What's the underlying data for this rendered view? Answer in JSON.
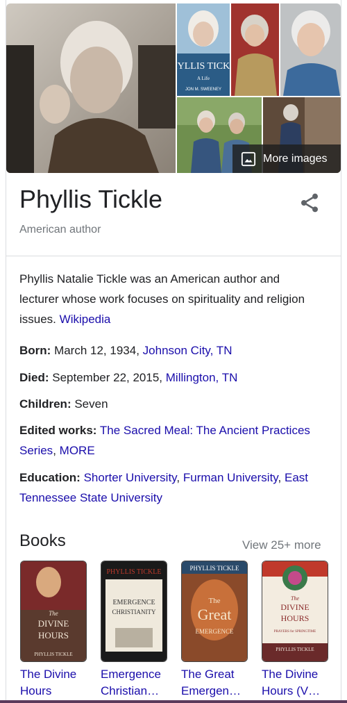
{
  "images": {
    "more_images_label": "More images",
    "book_cover_title": "PHYLLIS TICKLE",
    "book_cover_sub": "A Life",
    "book_cover_author": "JON M. SWEENEY"
  },
  "entity": {
    "title": "Phyllis Tickle",
    "subtitle": "American author",
    "description": "Phyllis Natalie Tickle was an American author and lecturer whose work focuses on spirituality and religion issues.",
    "description_source": "Wikipedia"
  },
  "facts": {
    "born_label": "Born:",
    "born_value": "March 12, 1934,",
    "born_link": "Johnson City, TN",
    "died_label": "Died:",
    "died_value": "September 22, 2015,",
    "died_link": "Millington, TN",
    "children_label": "Children:",
    "children_value": "Seven",
    "edited_label": "Edited works:",
    "edited_link": "The Sacred Meal: The Ancient Practices Series",
    "edited_sep": ",",
    "edited_more": "MORE",
    "education_label": "Education:",
    "education_link_1": "Shorter University",
    "education_sep_1": ",",
    "education_link_2": "Furman University",
    "education_sep_2": ",",
    "education_link_3": "East Tennessee State University"
  },
  "books": {
    "heading": "Books",
    "view_more": "View 25+ more",
    "items": [
      {
        "line1": "The Divine",
        "line2": "Hours",
        "cover_text_1": "The",
        "cover_text_2": "DIVINE",
        "cover_text_3": "HOURS",
        "cover_author": "PHYLLIS TICKLE"
      },
      {
        "line1": "Emergence",
        "line2": "Christian…",
        "cover_author": "PHYLLIS TICKLE",
        "cover_text_1": "EMERGENCE",
        "cover_text_2": "CHRISTIANITY"
      },
      {
        "line1": "The Great",
        "line2": "Emergen…",
        "cover_author": "PHYLLIS TICKLE",
        "cover_text_1": "The",
        "cover_text_2": "Great",
        "cover_text_3": "EMERGENCE"
      },
      {
        "line1": "The Divine",
        "line2": "Hours (V…",
        "cover_author": "PHYLLIS TICKLE",
        "cover_text_1": "The",
        "cover_text_2": "DIVINE",
        "cover_text_3": "HOURS",
        "cover_text_4": "PRAYERS for SPRINGTIME"
      }
    ]
  },
  "colors": {
    "link": "#1a0dab",
    "muted": "#70757a",
    "text": "#202124",
    "divider": "#dadce0"
  }
}
